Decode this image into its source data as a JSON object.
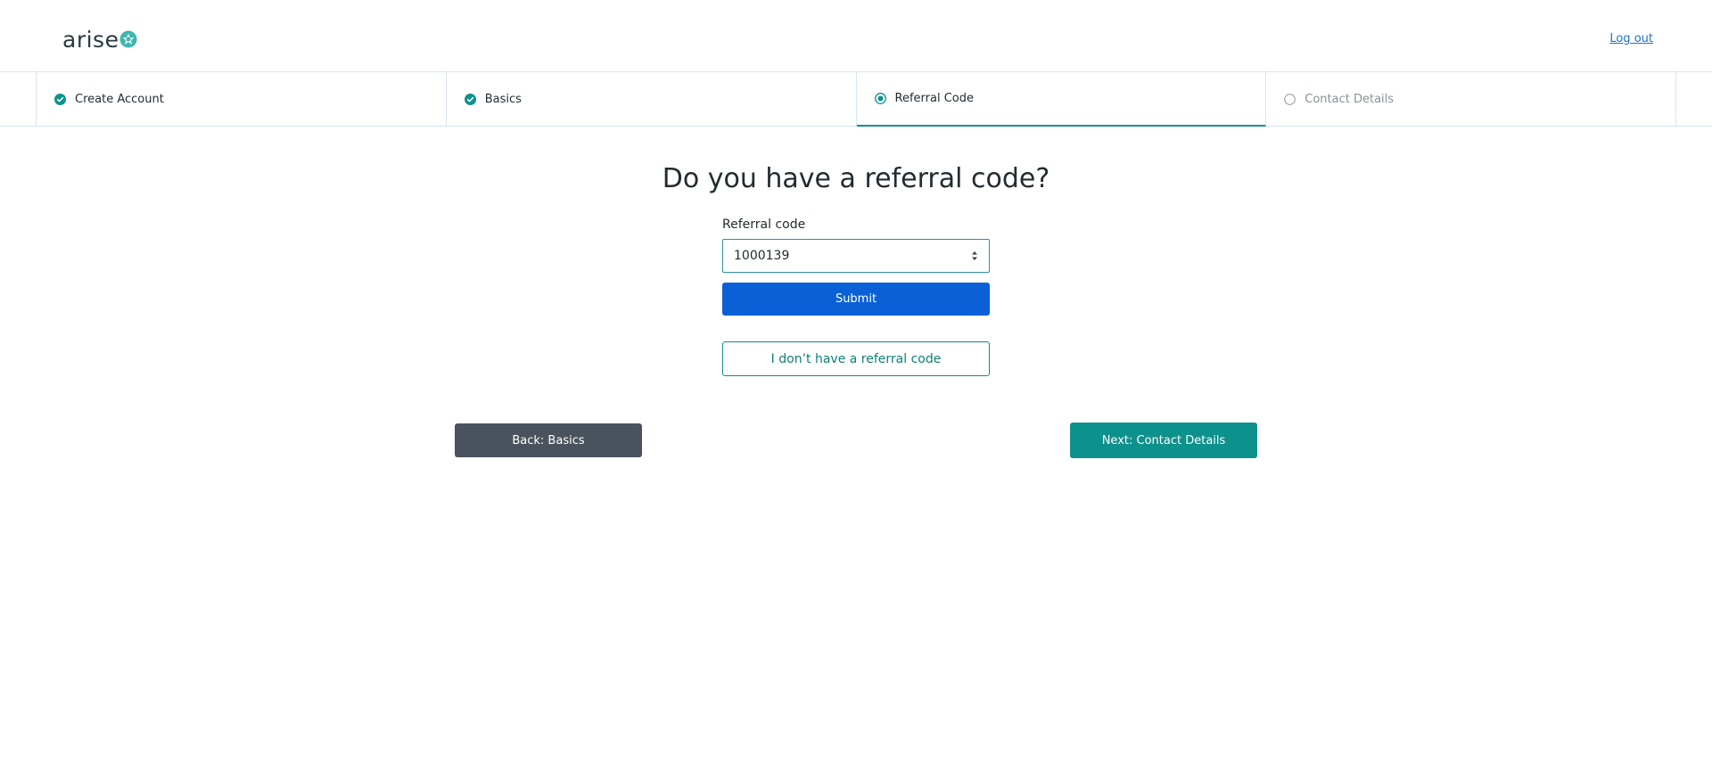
{
  "header": {
    "logo_text": "arise",
    "logout_label": "Log out"
  },
  "stepper": {
    "steps": [
      {
        "label": "Create Account",
        "status": "complete"
      },
      {
        "label": "Basics",
        "status": "complete"
      },
      {
        "label": "Referral Code",
        "status": "active"
      },
      {
        "label": "Contact Details",
        "status": "pending"
      }
    ]
  },
  "main": {
    "title": "Do you have a referral code?",
    "referral_label": "Referral code",
    "referral_value": "1000139",
    "submit_label": "Submit",
    "no_code_label": "I don’t have a referral code"
  },
  "nav": {
    "back_label": "Back: Basics",
    "next_label": "Next: Contact Details"
  },
  "colors": {
    "accent_teal": "#0d918c",
    "primary_blue": "#0a60d6",
    "back_gray": "#4a535d",
    "link_blue": "#1e72c8"
  },
  "icons": {
    "logo": "flower-icon",
    "complete": "check-circle-icon",
    "active": "radio-selected-icon",
    "pending": "radio-empty-icon"
  }
}
